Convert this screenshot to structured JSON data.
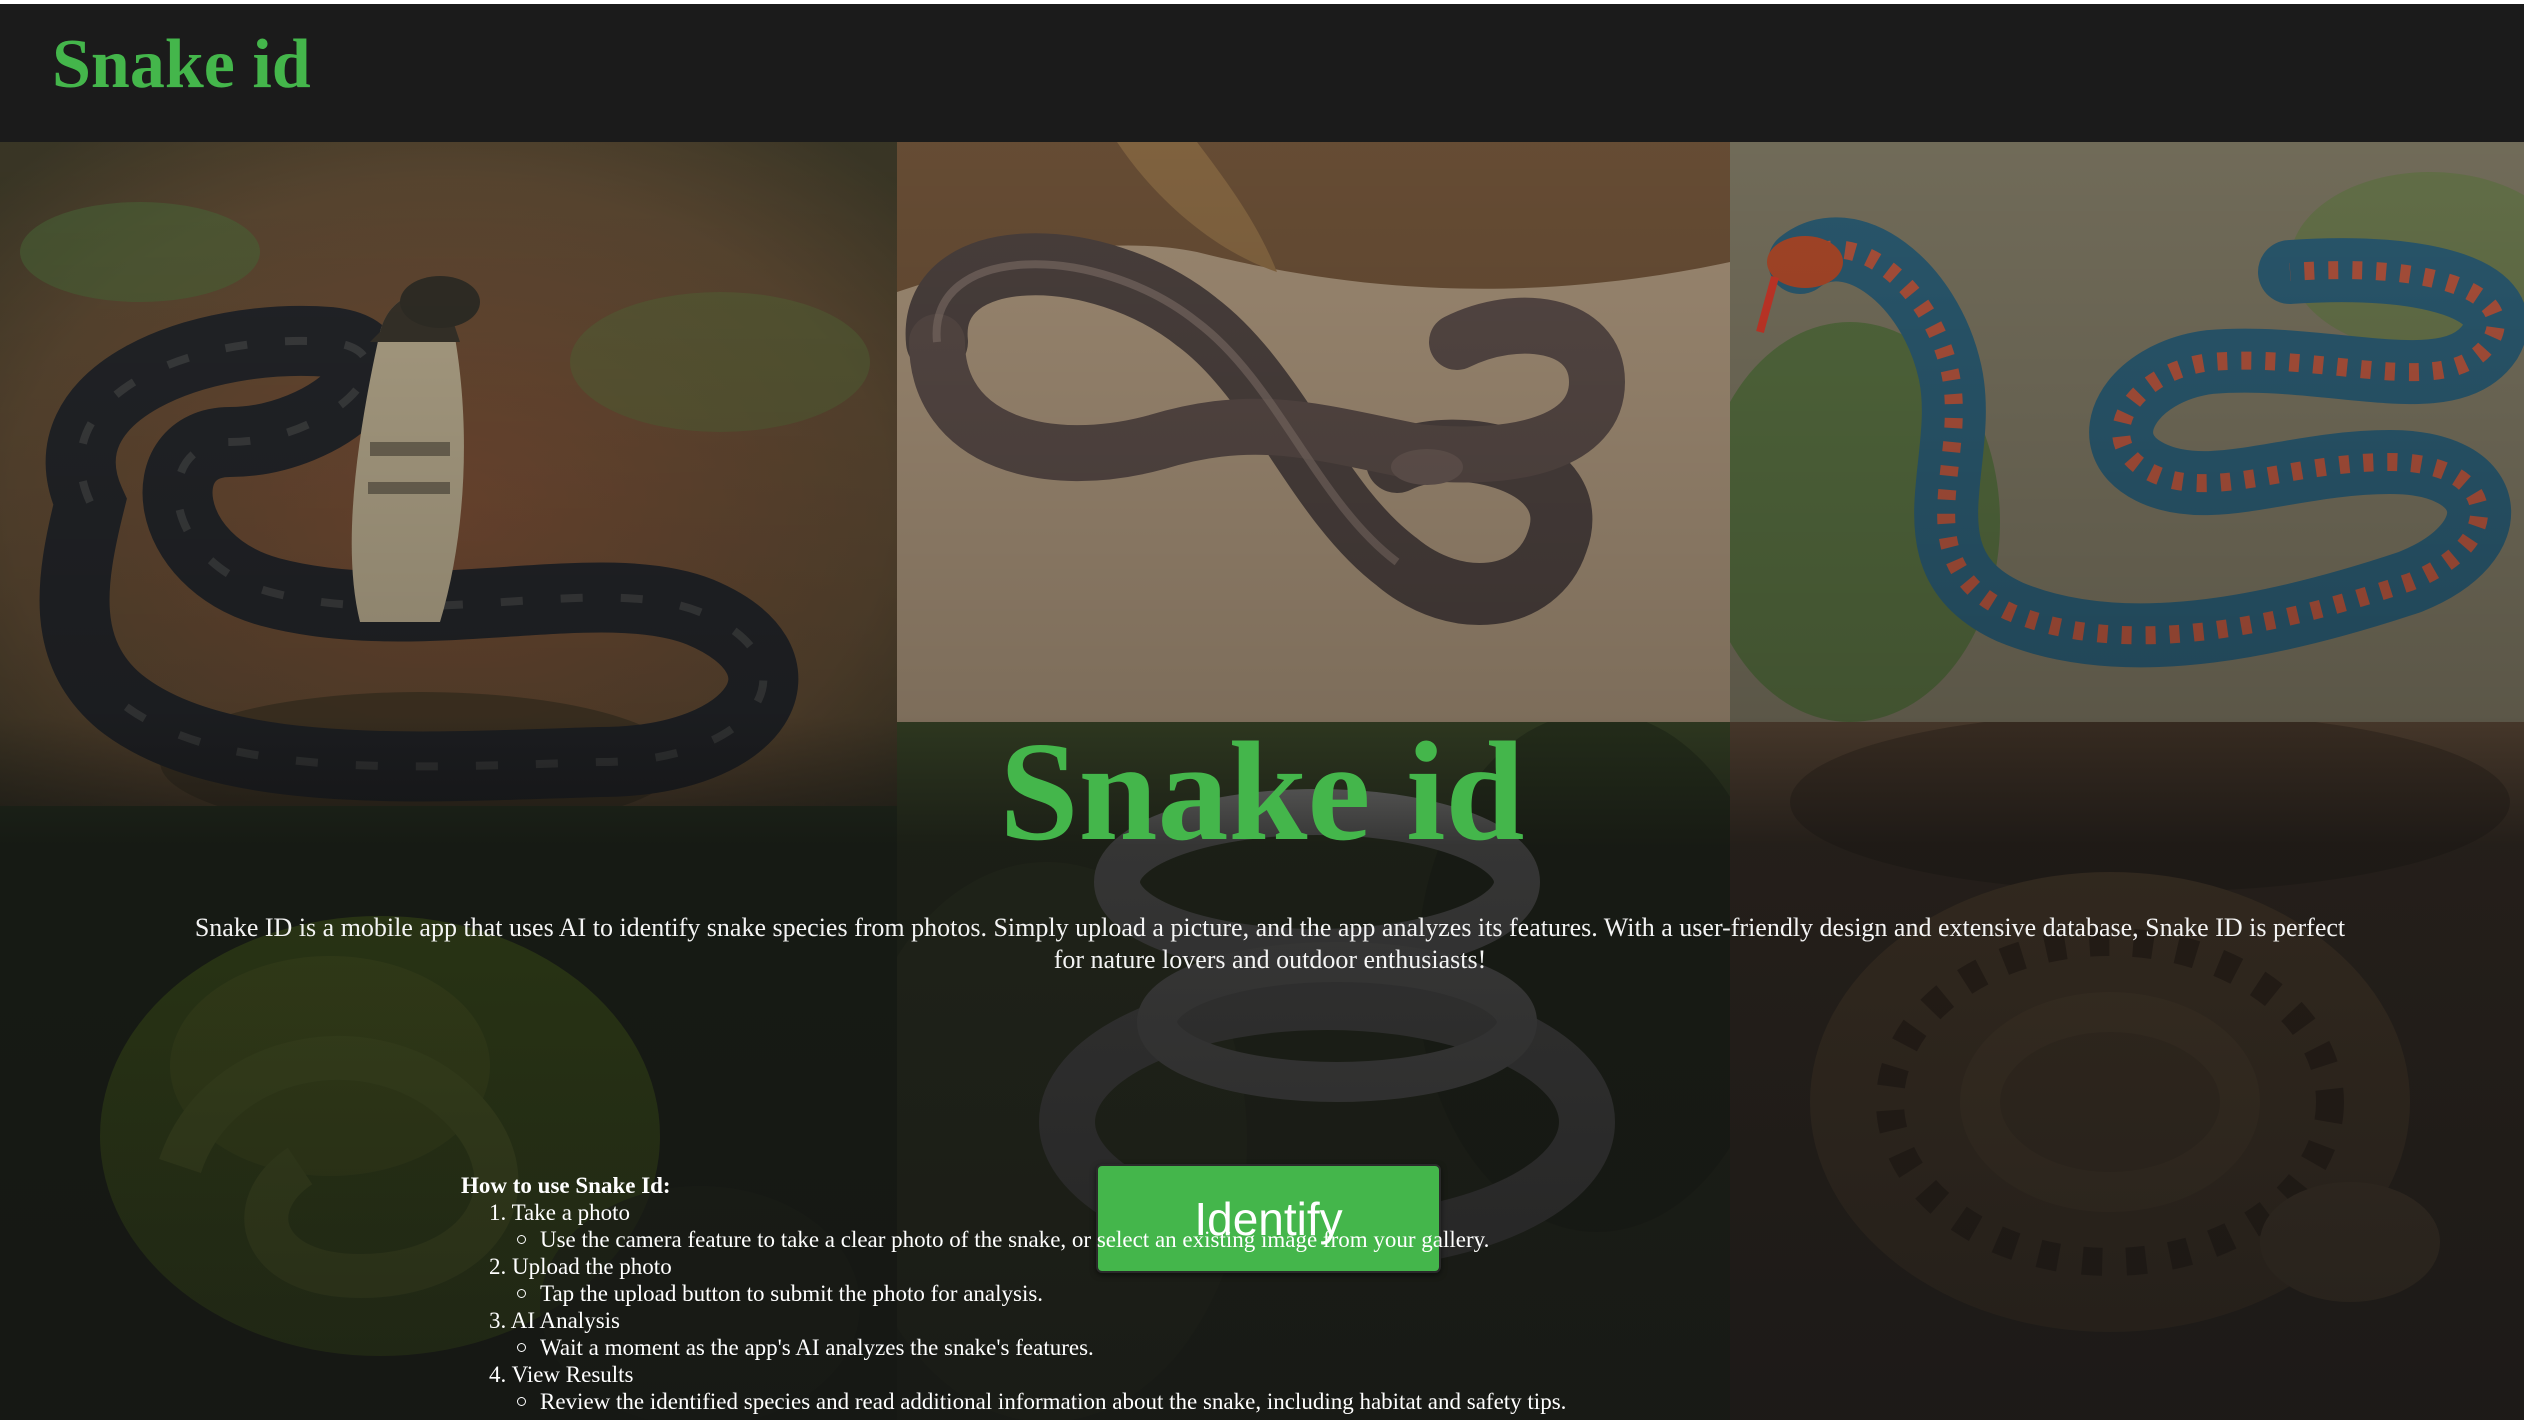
{
  "navbar": {
    "brand": "Snake id"
  },
  "hero": {
    "title": "Snake id",
    "description": "Snake ID is a mobile app that uses AI to identify snake species from photos. Simply upload a picture, and the app analyzes its features. With a user-friendly design and extensive database, Snake ID is perfect for nature lovers and outdoor enthusiasts!",
    "button_label": "Identify"
  },
  "howto": {
    "title": "How to use Snake Id:",
    "steps": [
      {
        "label": "1. Take a photo",
        "detail": "Use the camera feature to take a clear photo of the snake, or select an existing image from your gallery."
      },
      {
        "label": "2. Upload the photo",
        "detail": "Tap the upload button to submit the photo for analysis."
      },
      {
        "label": "3. AI Analysis",
        "detail": "Wait a moment as the app's AI analyzes the snake's features."
      },
      {
        "label": "4. View Results",
        "detail": "Review the identified species and read additional information about the snake, including habitat and safety tips."
      }
    ]
  },
  "colors": {
    "accent": "#44b64b",
    "navbar": "#1b1b1b",
    "text": "#ffffff"
  }
}
